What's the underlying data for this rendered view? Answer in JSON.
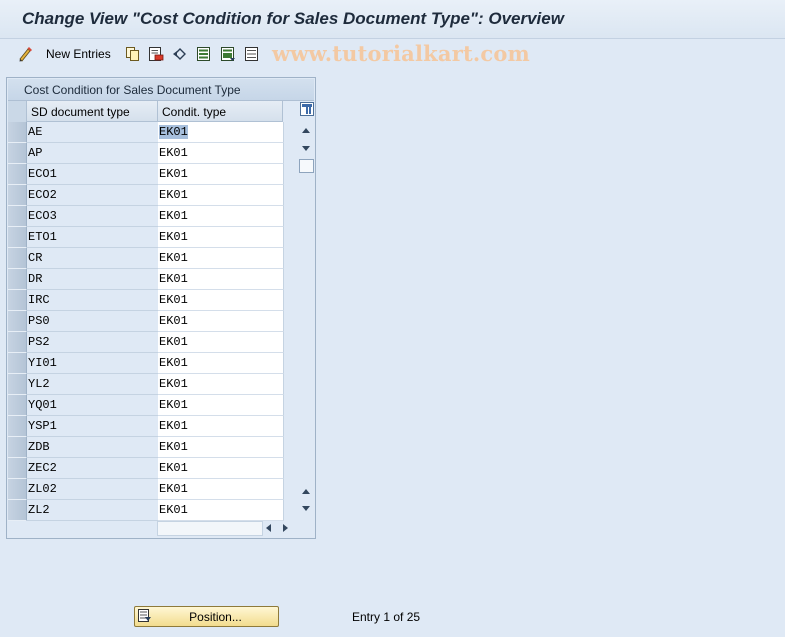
{
  "window": {
    "title": "Change View \"Cost Condition for Sales Document Type\": Overview"
  },
  "toolbar": {
    "new_entries_label": "New Entries",
    "icons": [
      "change-display-icon",
      "copy-icon",
      "delete-icon",
      "undo-icon",
      "select-all-icon",
      "select-block-icon",
      "deselect-all-icon"
    ],
    "watermark": "www.tutorialkart.com"
  },
  "table": {
    "title": "Cost Condition for Sales Document Type",
    "columns": [
      "SD document type",
      "Condit. type"
    ],
    "rows": [
      {
        "sd_type": "AE",
        "cond_type": "EK01"
      },
      {
        "sd_type": "AP",
        "cond_type": "EK01"
      },
      {
        "sd_type": "ECO1",
        "cond_type": "EK01"
      },
      {
        "sd_type": "ECO2",
        "cond_type": "EK01"
      },
      {
        "sd_type": "ECO3",
        "cond_type": "EK01"
      },
      {
        "sd_type": "ETO1",
        "cond_type": "EK01"
      },
      {
        "sd_type": "CR",
        "cond_type": "EK01"
      },
      {
        "sd_type": "DR",
        "cond_type": "EK01"
      },
      {
        "sd_type": "IRC",
        "cond_type": "EK01"
      },
      {
        "sd_type": "PS0",
        "cond_type": "EK01"
      },
      {
        "sd_type": "PS2",
        "cond_type": "EK01"
      },
      {
        "sd_type": "YI01",
        "cond_type": "EK01"
      },
      {
        "sd_type": "YL2",
        "cond_type": "EK01"
      },
      {
        "sd_type": "YQ01",
        "cond_type": "EK01"
      },
      {
        "sd_type": "YSP1",
        "cond_type": "EK01"
      },
      {
        "sd_type": "ZDB",
        "cond_type": "EK01"
      },
      {
        "sd_type": "ZEC2",
        "cond_type": "EK01"
      },
      {
        "sd_type": "ZL02",
        "cond_type": "EK01"
      },
      {
        "sd_type": "ZL2",
        "cond_type": "EK01"
      }
    ]
  },
  "footer": {
    "position_label": "Position...",
    "entry_text": "Entry 1 of 25"
  },
  "colors": {
    "background": "#dfe9f5",
    "button_yellow": "#f2dc8e",
    "selection": "#a7bfdc"
  }
}
